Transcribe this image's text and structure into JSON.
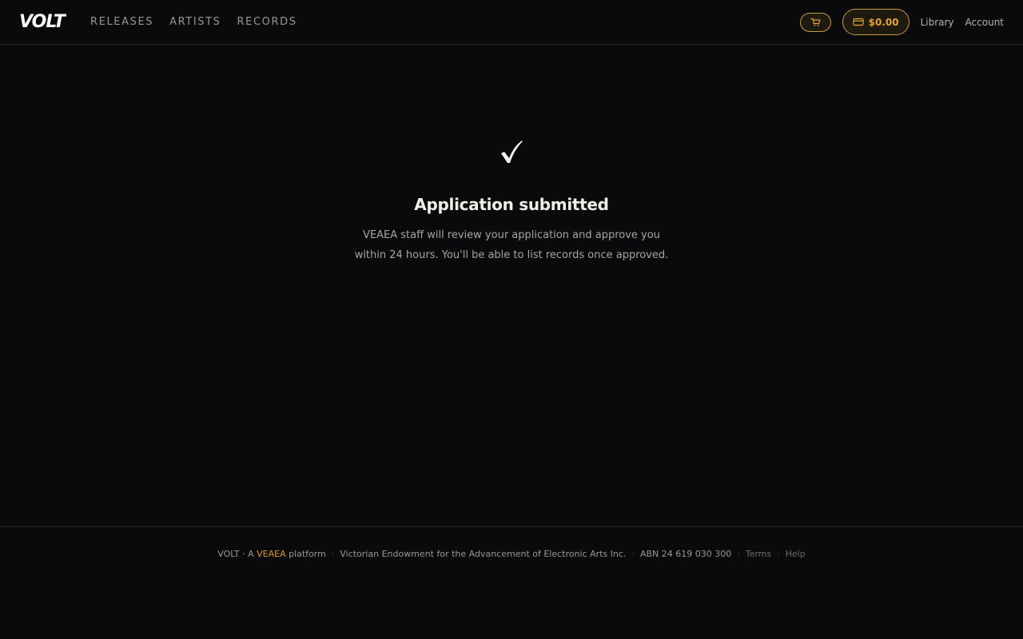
{
  "header": {
    "logo": "VOLT",
    "nav": [
      "RELEASES",
      "ARTISTS",
      "RECORDS"
    ],
    "cart_icon": "cart-icon",
    "wallet_icon": "wallet-icon",
    "wallet_amount": "$0.00",
    "links": [
      "Library",
      "Account"
    ]
  },
  "main": {
    "check_icon": "checkmark-icon",
    "title": "Application submitted",
    "description_line1": "VEAEA staff will review your application and approve you",
    "description_line2": "within 24 hours. You'll be able to list records once approved."
  },
  "footer": {
    "brand": "VOLT · A ",
    "org_short": "VEAEA",
    "platform": " platform",
    "org_full": "Victorian Endowment for the Advancement of Electronic Arts Inc.",
    "abn": "ABN 24 619 030 300",
    "terms": "Terms",
    "help": "Help",
    "separator": "·"
  },
  "colors": {
    "background": "#0a0a0c",
    "accent": "#e3a43a",
    "border": "#2a2a2e"
  }
}
